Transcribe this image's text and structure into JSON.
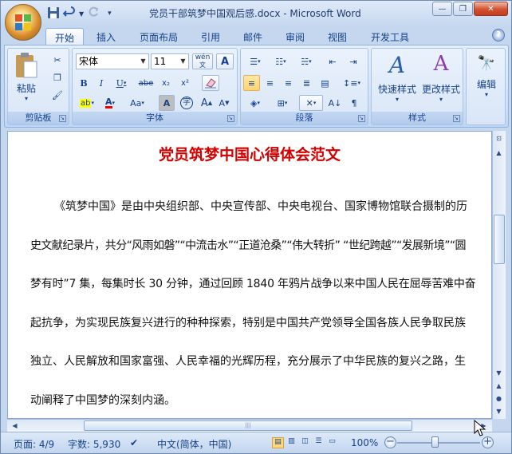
{
  "window": {
    "title": "党员干部筑梦中国观后感.docx - Microsoft Word",
    "minimize_glyph": "—",
    "restore_glyph": "❐",
    "close_glyph": "✕"
  },
  "quick_access": {
    "save_icon": "save-icon",
    "undo_icon": "undo-icon",
    "redo_icon": "redo-icon",
    "customize_icon": "chevron-down-icon"
  },
  "tabs": [
    "开始",
    "插入",
    "页面布局",
    "引用",
    "邮件",
    "审阅",
    "视图",
    "开发工具"
  ],
  "active_tab": "开始",
  "ribbon": {
    "clipboard": {
      "label": "剪贴板",
      "paste": "粘贴"
    },
    "font": {
      "label": "字体",
      "font_name": "宋体",
      "font_size": "11",
      "grow": "A",
      "shrink": "A",
      "bold": "B",
      "italic": "I",
      "underline": "U",
      "strike": "abe",
      "sub": "x₂",
      "sup": "x²",
      "change_case": "Aa",
      "char_shade": "A",
      "enclose": "字",
      "wen": "wén",
      "font_color": "A",
      "char_border": "A",
      "phonetic": "A"
    },
    "paragraph": {
      "label": "段落"
    },
    "styles": {
      "label": "样式",
      "quick_styles": "快速样式",
      "change_styles": "更改样式"
    },
    "editing": {
      "label": "编辑",
      "find": "编辑"
    }
  },
  "document": {
    "heading": "党员筑梦中国心得体会范文",
    "lines": [
      "《筑梦中国》是由中央组织部、中央宣传部、中央电视台、国家博物馆联合摄制的历",
      "史文献纪录片，共分“风雨如磐”“中流击水”“正道沧桑”“伟大转折” “世纪跨越”“发展新境”“圆",
      "梦有时”7 集，每集时长 30 分钟，通过回顾 1840 年鸦片战争以来中国人民在屈辱苦难中奋",
      "起抗争，为实现民族复兴进行的种种探索，特别是中国共产党领导全国各族人民争取民族",
      "独立、人民解放和国家富强、人民幸福的光辉历程，充分展示了中华民族的复兴之路，生",
      "动阐释了中国梦的深刻内涵。"
    ]
  },
  "status_bar": {
    "page": "页面: 4/9",
    "words": "字数: 5,930",
    "language": "中文(简体，中国)",
    "zoom": "100%",
    "zoom_minus": "−",
    "zoom_plus": "+"
  },
  "colors": {
    "heading": "#d40000",
    "ribbon": "#d0e0f5",
    "tab_text": "#15428b"
  }
}
